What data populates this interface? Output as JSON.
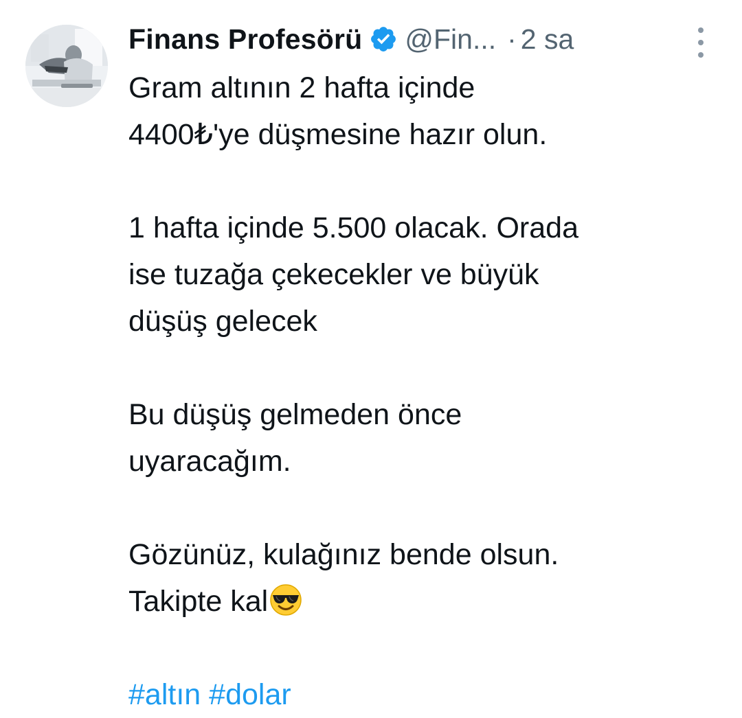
{
  "tweet": {
    "author": {
      "display_name": "Finans Profesörü",
      "verified_icon": "verified-badge-icon",
      "handle": "@Fin...",
      "separator": "·",
      "time": "2 sa"
    },
    "paragraphs": [
      [
        "Gram altının 2 hafta içinde",
        "4400₺'ye düşmesine hazır olun."
      ],
      [
        "1 hafta içinde 5.500 olacak. Orada",
        "ise tuzağa çekecekler ve büyük",
        "düşüş gelecek"
      ],
      [
        "Bu düşüş gelmeden önce",
        "uyaracağım."
      ],
      [
        "Gözünüz, kulağınız bende olsun.",
        "Takipte kal"
      ]
    ],
    "emoji": "smiling-face-with-sunglasses-icon",
    "hashtags": [
      "#altın",
      "#dolar"
    ],
    "more_icon": "more-vertical-icon"
  },
  "colors": {
    "text": "#0f1419",
    "secondary": "#536471",
    "link": "#1d9bf0",
    "verified": "#1d9bf0"
  }
}
